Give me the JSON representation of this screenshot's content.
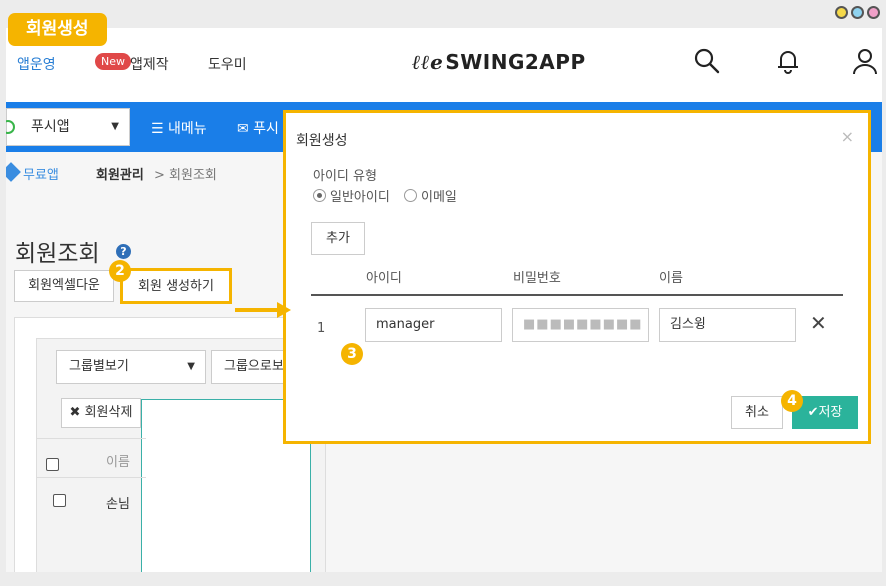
{
  "tag": {
    "title": "회원생성"
  },
  "header": {
    "nav": {
      "app": "앱운영",
      "new_badge": "New",
      "make": "앱제작",
      "help": "도우미"
    },
    "logo": {
      "mark": "ℓℓe",
      "text": "SWING2APP"
    }
  },
  "toolbar": {
    "app_select": "푸시앱",
    "my_menu": "☰ 내메뉴",
    "push": "✉ 푸시"
  },
  "breadcrumb": {
    "free": "무료앱",
    "main": "회원관리",
    "sub": "> 회원조회"
  },
  "page": {
    "title": "회원조회",
    "help": "?",
    "excel_button": "회원엑셀다운",
    "create_button": "회원 생성하기"
  },
  "list": {
    "group_select": "그룹별보기",
    "group_select2": "그룹으로보",
    "delete_button": "회원삭제",
    "col_name": "이름",
    "row_name": "손님"
  },
  "badges": {
    "b2": "2",
    "b3": "3",
    "b4": "4"
  },
  "modal": {
    "title": "회원생성",
    "close": "×",
    "id_type_label": "아이디 유형",
    "radio_general": "일반아이디",
    "radio_email": "이메일",
    "add_button": "추가",
    "col_id": "아이디",
    "col_pw": "비밀번호",
    "col_name": "이름",
    "row_num": "1",
    "row_id": "manager",
    "row_pw": "■■■■■■■■■",
    "row_name": "김스윙",
    "remove": "✕",
    "cancel_button": "취소",
    "save_button": "✔저장"
  }
}
